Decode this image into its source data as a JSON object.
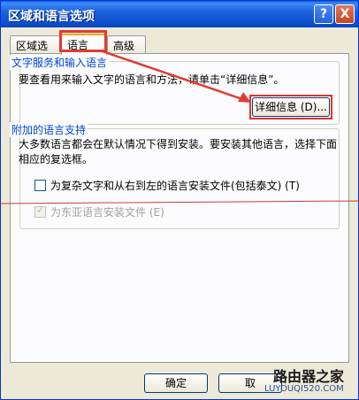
{
  "window": {
    "title": "区域和语言选项",
    "help": "?",
    "close": "X"
  },
  "tabs": [
    {
      "label": "区域选项"
    },
    {
      "label": "语言"
    },
    {
      "label": "高级"
    }
  ],
  "group1": {
    "legend": "文字服务和输入语言",
    "desc": "要查看用来输入文字的语言和方法，请单击“详细信息”。",
    "details_button": "详细信息 (D)..."
  },
  "group2": {
    "legend": "附加的语言支持",
    "desc": "大多数语言都会在默认情况下得到安装。要安装其他语言，选择下面相应的复选框。",
    "complex_label": "为复杂文字和从右到左的语言安装文件(包括泰文) (T)",
    "east_asian_label": "为东亚语言安装文件 (E)"
  },
  "buttons": {
    "ok": "确定",
    "cancel": "取"
  },
  "watermark": {
    "logo": "路由器之家",
    "url": "LUYOUQI520.COM"
  },
  "colors": {
    "annotation": "#e03a32",
    "titlebar": "#0a4dcb"
  }
}
